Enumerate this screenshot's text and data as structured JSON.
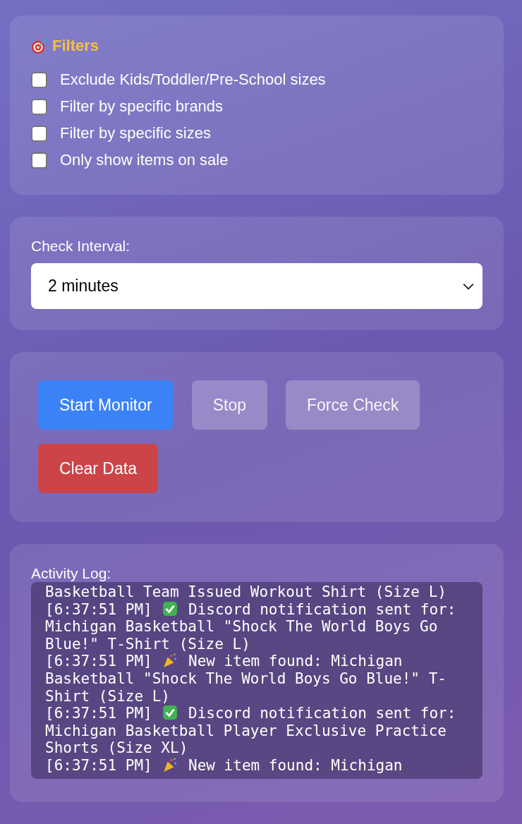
{
  "filters": {
    "title": "Filters",
    "options": [
      {
        "label": "Exclude Kids/Toddler/Pre-School sizes",
        "checked": false
      },
      {
        "label": "Filter by specific brands",
        "checked": false
      },
      {
        "label": "Filter by specific sizes",
        "checked": false
      },
      {
        "label": "Only show items on sale",
        "checked": false
      }
    ]
  },
  "interval": {
    "label": "Check Interval:",
    "value": "2 minutes"
  },
  "buttons": [
    {
      "label": "Start Monitor",
      "kind": "primary",
      "disabled": false
    },
    {
      "label": "Stop",
      "kind": "secondary",
      "disabled": true
    },
    {
      "label": "Force Check",
      "kind": "secondary",
      "disabled": true
    },
    {
      "label": "Clear Data",
      "kind": "danger",
      "disabled": false
    }
  ],
  "log": {
    "label": "Activity Log:",
    "entries": [
      {
        "kind": "plain",
        "text": "Basketball Team Issued Workout Shirt (Size L)"
      },
      {
        "kind": "sent",
        "time": "[6:37:51 PM]",
        "text": "Discord notification sent for: Michigan Basketball \"Shock The World Boys Go Blue!\" T-Shirt (Size L)"
      },
      {
        "kind": "found",
        "time": "[6:37:51 PM]",
        "text": "New item found: Michigan Basketball \"Shock The World Boys Go Blue!\" T-Shirt (Size L)"
      },
      {
        "kind": "sent",
        "time": "[6:37:51 PM]",
        "text": "Discord notification sent for: Michigan Basketball Player Exclusive Practice Shorts (Size XL)"
      },
      {
        "kind": "found",
        "time": "[6:37:51 PM]",
        "text": "New item found: Michigan"
      }
    ]
  }
}
